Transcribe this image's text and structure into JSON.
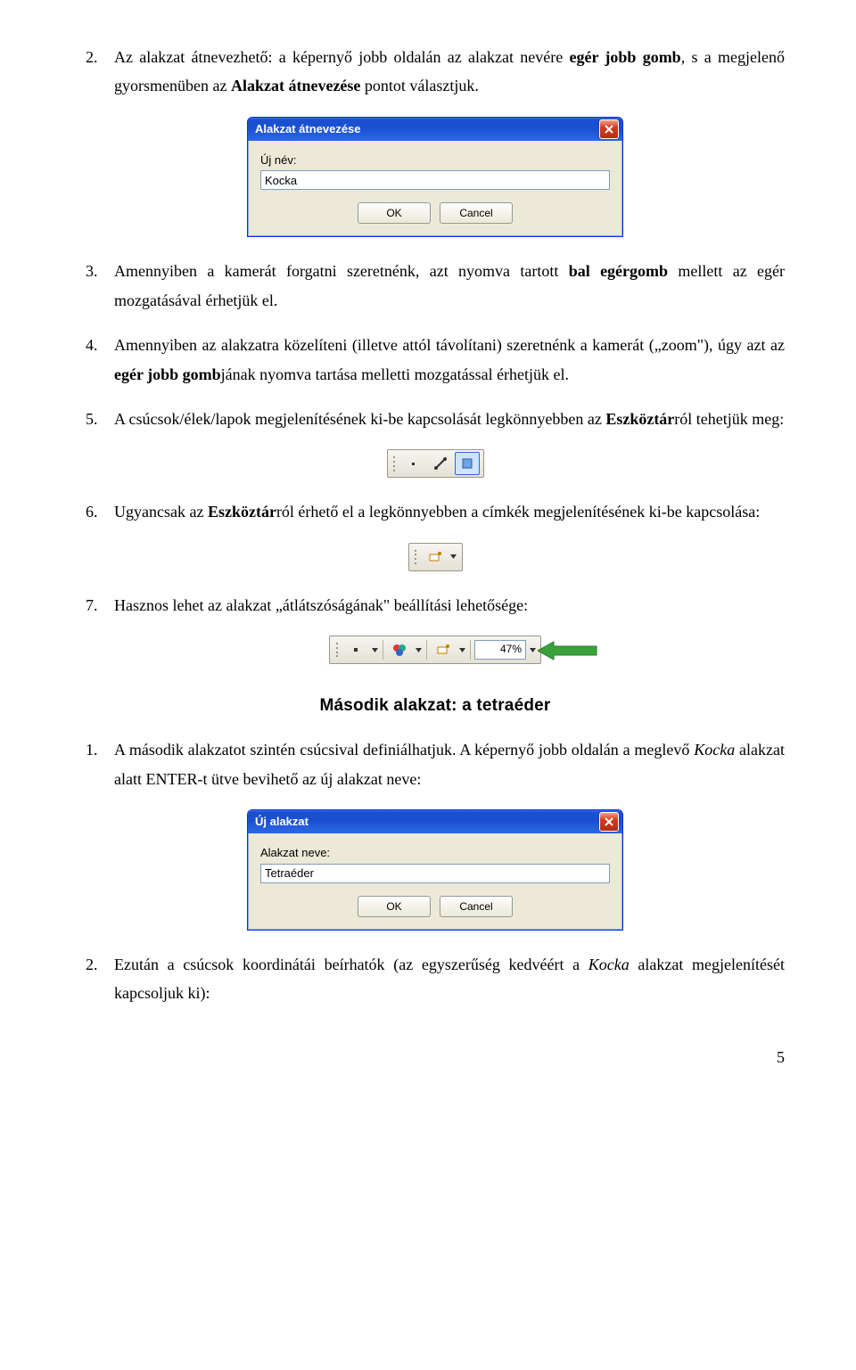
{
  "items1": [
    {
      "num": "2.",
      "text_parts": [
        "Az alakzat átnevezhető: a képernyő jobb oldalán az alakzat nevére ",
        "egér jobb gomb",
        ", s a megjelenő gyorsmenüben az ",
        "Alakzat átnevezése",
        " pontot választjuk."
      ]
    }
  ],
  "dialog1": {
    "title": "Alakzat átnevezése",
    "label": "Új név:",
    "value": "Kocka",
    "ok": "OK",
    "cancel": "Cancel"
  },
  "items2": [
    {
      "num": "3.",
      "parts": [
        "Amennyiben a kamerát forgatni szeretnénk, azt nyomva tartott ",
        "bal egérgomb",
        " mellett az egér mozgatásával érhetjük el."
      ]
    },
    {
      "num": "4.",
      "parts": [
        "Amennyiben az alakzatra közelíteni (illetve attól távolítani) szeretnénk a kamerát („zoom\"), úgy azt az ",
        "egér jobb gomb",
        "jának nyomva tartása melletti mozgatással érhetjük el."
      ]
    },
    {
      "num": "5.",
      "parts": [
        "A csúcsok/élek/lapok megjelenítésének ki-be kapcsolását legkönnyebben az ",
        "Eszköztár",
        "ról tehetjük meg:"
      ]
    }
  ],
  "items3": [
    {
      "num": "6.",
      "parts": [
        "Ugyancsak az ",
        "Eszköztár",
        "ról érhető el a legkönnyebben a címkék megjelenítésének ki-be kapcsolása:"
      ]
    }
  ],
  "items4": [
    {
      "num": "7.",
      "parts": [
        "Hasznos lehet az alakzat „átlátszóságának\" beállítási lehetősége:"
      ]
    }
  ],
  "toolbar3_percent": "47%",
  "section_title": "Második alakzat: a tetraéder",
  "items5": [
    {
      "num": "1.",
      "parts": [
        "A második alakzatot szintén csúcsival definiálhatjuk. A képernyő jobb oldalán a meglevő ",
        "Kocka",
        " alakzat alatt ENTER-t ütve bevihető az új alakzat neve:"
      ]
    }
  ],
  "dialog2": {
    "title": "Új alakzat",
    "label": "Alakzat neve:",
    "value": "Tetraéder",
    "ok": "OK",
    "cancel": "Cancel"
  },
  "items6": [
    {
      "num": "2.",
      "parts": [
        "Ezután a csúcsok koordinátái beírhatók (az egyszerűség kedvéért a ",
        "Kocka",
        " alakzat megjelenítését kapcsoljuk ki):"
      ]
    }
  ],
  "page_number": "5"
}
